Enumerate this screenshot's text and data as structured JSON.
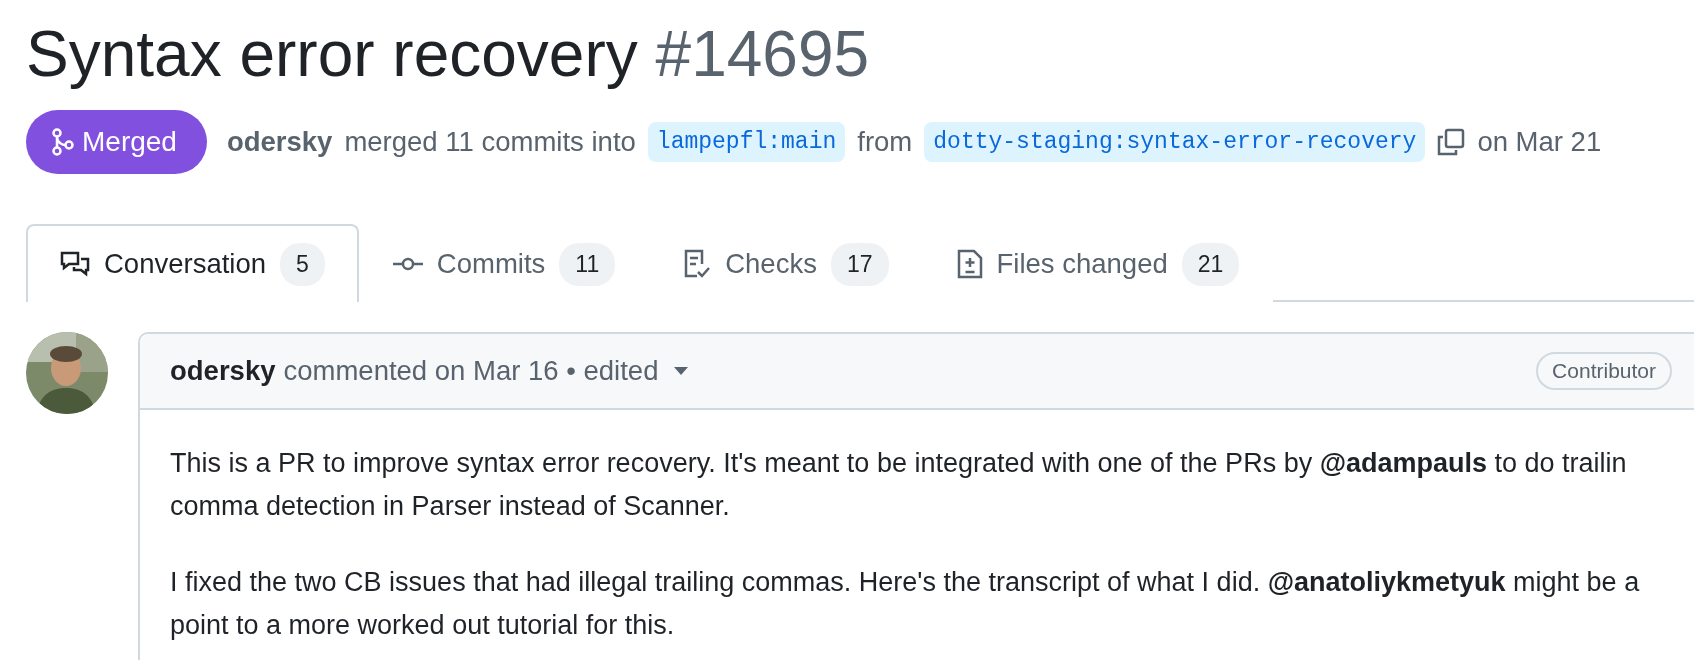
{
  "title": {
    "text": "Syntax error recovery",
    "number": "#14695"
  },
  "state": {
    "label": "Merged",
    "kind": "merged"
  },
  "meta": {
    "author": "odersky",
    "action": "merged 11 commits into",
    "base": "lampepfl:main",
    "from": "from",
    "head": "dotty-staging:syntax-error-recovery",
    "date": "on Mar 21"
  },
  "tabs": [
    {
      "label": "Conversation",
      "count": "5",
      "kind": "conversation",
      "selected": true
    },
    {
      "label": "Commits",
      "count": "11",
      "kind": "commits",
      "selected": false
    },
    {
      "label": "Checks",
      "count": "17",
      "kind": "checks",
      "selected": false
    },
    {
      "label": "Files changed",
      "count": "21",
      "kind": "files",
      "selected": false
    }
  ],
  "comment": {
    "author": "odersky",
    "info": "commented on Mar 16 • edited",
    "role": "Contributor",
    "paragraphs": [
      {
        "lines": [
          "This is a PR to improve syntax error recovery. It's meant to be integrated with one of the PRs by **@adampauls** to do trailin",
          "comma detection in Parser instead of Scanner."
        ]
      },
      {
        "lines": [
          "I fixed the two CB issues that had illegal trailing commas. Here's the transcript of what I did. **@anatoliykmetyuk** might be a",
          "point to a more worked out tutorial for this."
        ]
      }
    ]
  }
}
